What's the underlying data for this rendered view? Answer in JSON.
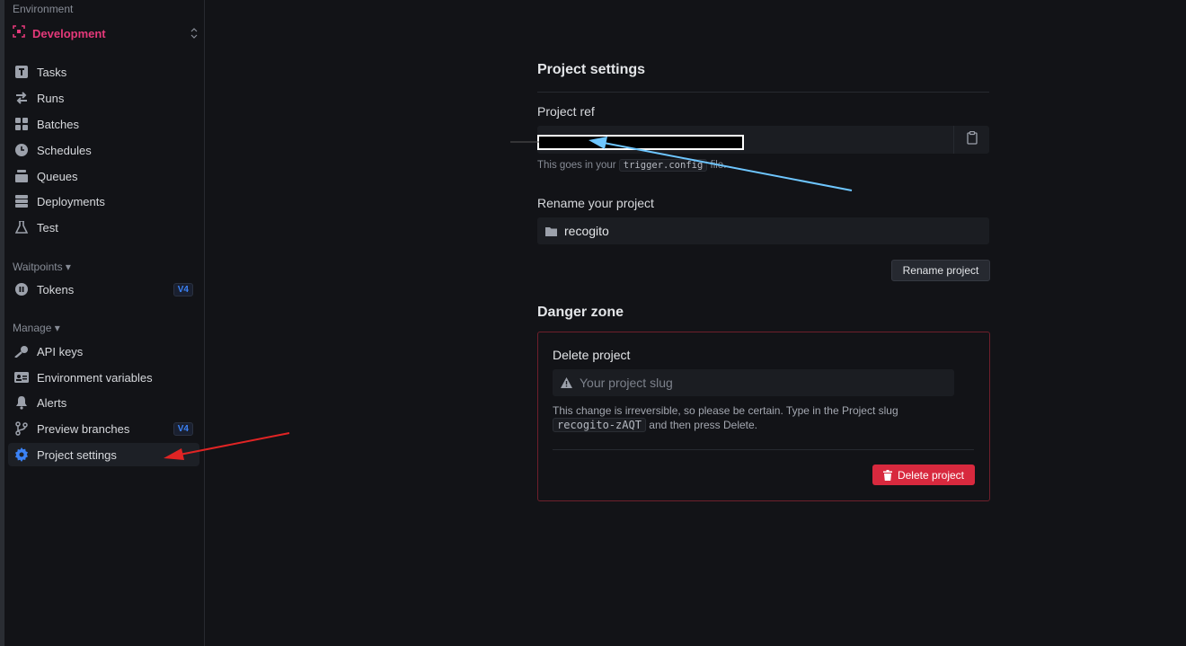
{
  "sidebar": {
    "environment_label": "Environment",
    "environment_name": "Development",
    "items": [
      {
        "label": "Tasks",
        "icon": "tasks-icon"
      },
      {
        "label": "Runs",
        "icon": "runs-icon"
      },
      {
        "label": "Batches",
        "icon": "batches-icon"
      },
      {
        "label": "Schedules",
        "icon": "clock-icon"
      },
      {
        "label": "Queues",
        "icon": "queues-icon"
      },
      {
        "label": "Deployments",
        "icon": "server-stack-icon"
      },
      {
        "label": "Test",
        "icon": "flask-icon"
      }
    ],
    "waitpoints_label": "Waitpoints",
    "waitpoints_items": [
      {
        "label": "Tokens",
        "icon": "pause-circle-icon",
        "badge": "V4"
      }
    ],
    "manage_label": "Manage",
    "manage_items": [
      {
        "label": "API keys",
        "icon": "key-icon"
      },
      {
        "label": "Environment variables",
        "icon": "id-card-icon"
      },
      {
        "label": "Alerts",
        "icon": "bell-icon"
      },
      {
        "label": "Preview branches",
        "icon": "branch-icon",
        "badge": "V4"
      },
      {
        "label": "Project settings",
        "icon": "gear-icon"
      }
    ]
  },
  "main": {
    "title": "Project settings",
    "project_ref_label": "Project ref",
    "project_ref_hint_prefix": "This goes in your",
    "project_ref_hint_code": "trigger.config",
    "project_ref_hint_suffix": "file.",
    "rename_label": "Rename your project",
    "project_name_value": "recogito",
    "rename_button": "Rename project",
    "danger_zone_title": "Danger zone",
    "delete_label": "Delete project",
    "slug_placeholder": "Your project slug",
    "danger_text_prefix": "This change is irreversible, so please be certain. Type in the Project slug",
    "danger_slug": "recogito-zAQT",
    "danger_text_suffix": "and then press Delete.",
    "delete_button": "Delete project"
  },
  "colors": {
    "environment": "#e5397a",
    "accent_blue": "#3b82f6",
    "danger": "#d8293e",
    "annotation_red": "#e02424",
    "annotation_blue": "#6ec6ff"
  }
}
